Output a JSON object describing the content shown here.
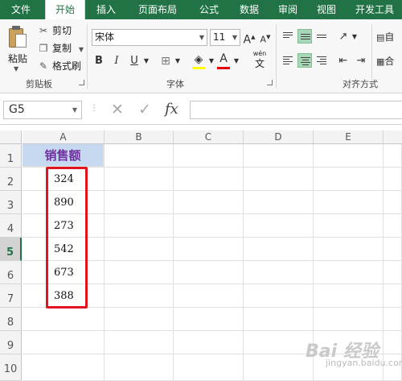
{
  "ribbon_tabs": [
    "文件",
    "开始",
    "插入",
    "页面布局",
    "公式",
    "数据",
    "审阅",
    "视图",
    "开发工具"
  ],
  "active_tab": "开始",
  "clipboard": {
    "paste": "粘贴",
    "cut": "剪切",
    "copy": "复制",
    "format_painter": "格式刷",
    "group": "剪贴板"
  },
  "font": {
    "name": "宋体",
    "size": "11",
    "bold": "B",
    "italic": "I",
    "underline": "U",
    "grow": "A",
    "shrink": "A",
    "wen": "wén",
    "wen2": "文",
    "font_color_letter": "A",
    "group": "字体",
    "fill_color": "#ffff00",
    "font_color": "#e00000"
  },
  "alignment": {
    "group": "对齐方式",
    "wrap_label": "自",
    "merge_label": "合"
  },
  "formula_bar": {
    "name_box": "G5",
    "cancel": "✕",
    "enter": "✓",
    "fx": "fx",
    "formula": ""
  },
  "grid": {
    "columns": [
      "A",
      "B",
      "C",
      "D",
      "E"
    ],
    "rows": [
      "1",
      "2",
      "3",
      "4",
      "5",
      "6",
      "7",
      "8",
      "9",
      "10"
    ],
    "active_row": "5",
    "header_cell": "销售额",
    "values": [
      "324",
      "890",
      "273",
      "542",
      "673",
      "388"
    ],
    "header_fill": "#c6d9f0",
    "header_text_color": "#7030a0",
    "highlight_border_color": "#e0141e"
  },
  "watermark": {
    "text": "Bai 经验",
    "sub": "jingyan.baidu.com"
  }
}
